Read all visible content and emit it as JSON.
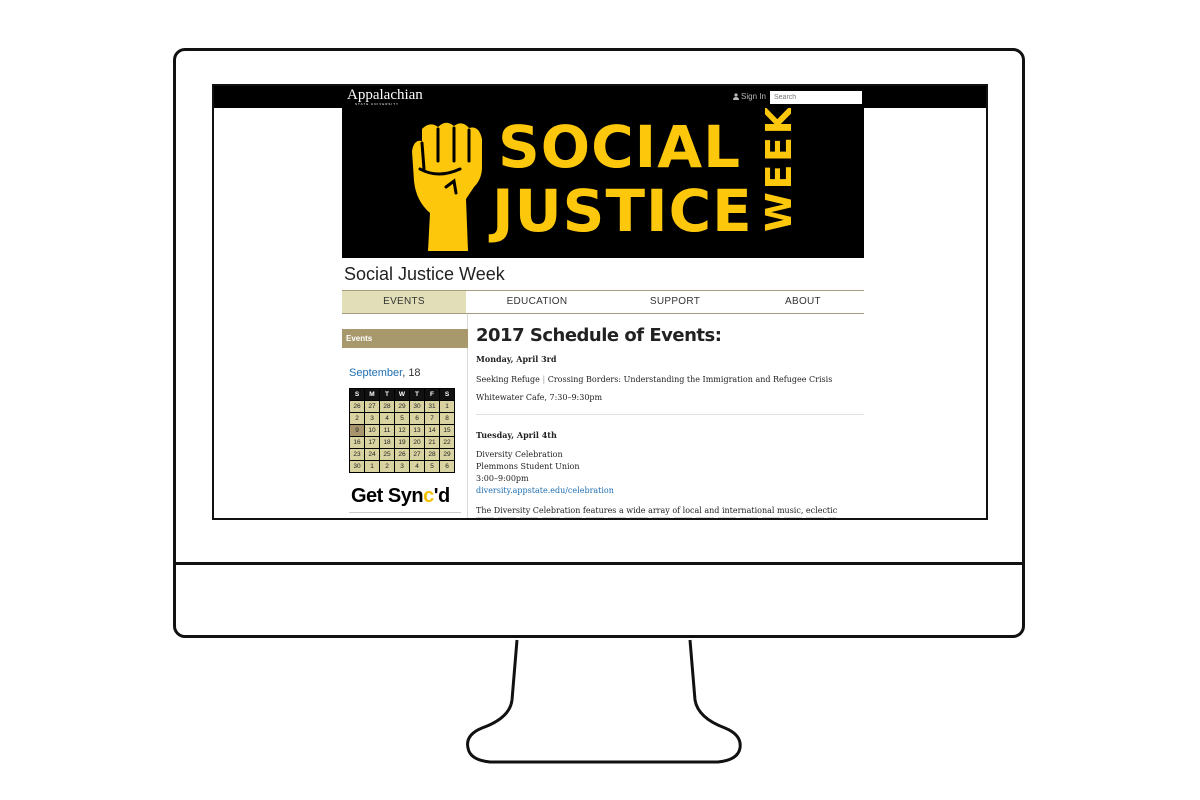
{
  "header": {
    "brand": "Appalachian",
    "brand_sub": "STATE UNIVERSITY",
    "signin_label": "Sign In",
    "search_placeholder": "Search"
  },
  "banner": {
    "word1": "SOCIAL",
    "word2": "JUSTICE",
    "word3": "WEEK",
    "accent_color": "#fdc80c"
  },
  "site_title": "Social Justice Week",
  "nav": {
    "items": [
      {
        "label": "EVENTS",
        "active": true
      },
      {
        "label": "EDUCATION"
      },
      {
        "label": "SUPPORT"
      },
      {
        "label": "ABOUT"
      }
    ]
  },
  "sidebar": {
    "heading": "Events",
    "calendar": {
      "month": "September",
      "year_suffix": ", 18",
      "days": [
        "S",
        "M",
        "T",
        "W",
        "T",
        "F",
        "S"
      ],
      "weeks": [
        [
          "26",
          "27",
          "28",
          "29",
          "30",
          "31",
          "1"
        ],
        [
          "2",
          "3",
          "4",
          "5",
          "6",
          "7",
          "8"
        ],
        [
          "9",
          "10",
          "11",
          "12",
          "13",
          "14",
          "15"
        ],
        [
          "16",
          "17",
          "18",
          "19",
          "20",
          "21",
          "22"
        ],
        [
          "23",
          "24",
          "25",
          "26",
          "27",
          "28",
          "29"
        ],
        [
          "30",
          "1",
          "2",
          "3",
          "4",
          "5",
          "6"
        ]
      ],
      "today": "9"
    },
    "synced_a": "Get Syn",
    "synced_c": "c",
    "synced_b": "'d"
  },
  "main": {
    "title": "2017 Schedule of Events:",
    "event1": {
      "date": "Monday, April 3rd",
      "title_a": "Seeking Refuge",
      "separator": "|",
      "title_b": "Crossing Borders: Understanding the Immigration and Refugee Crisis",
      "location": "Whitewater Cafe, 7:30–9:30pm"
    },
    "event2": {
      "date": "Tuesday, April 4th",
      "name": "Diversity Celebration",
      "place": "Plemmons Student Union",
      "time": "3:00–9:00pm",
      "link": "diversity.appstate.edu/celebration",
      "description": "The Diversity Celebration features a wide array of local and international music, eclectic"
    }
  }
}
